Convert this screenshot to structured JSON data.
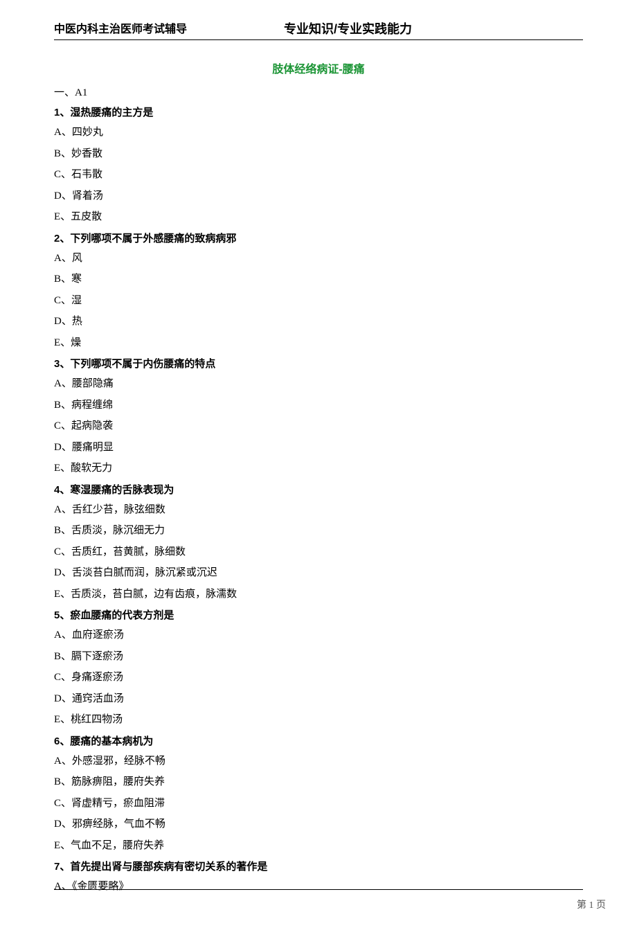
{
  "header": {
    "left": "中医内科主治医师考试辅导",
    "center": "专业知识/专业实践能力"
  },
  "title": "肢体经络病证-腰痛",
  "section_label": "一、A1",
  "questions": [
    {
      "stem": "1、湿热腰痛的主方是",
      "options": [
        "A、四妙丸",
        "B、妙香散",
        "C、石韦散",
        "D、肾着汤",
        "E、五皮散"
      ]
    },
    {
      "stem": "2、下列哪项不属于外感腰痛的致病病邪",
      "options": [
        "A、风",
        "B、寒",
        "C、湿",
        "D、热",
        "E、燥"
      ]
    },
    {
      "stem": "3、下列哪项不属于内伤腰痛的特点",
      "options": [
        "A、腰部隐痛",
        "B、病程缠绵",
        "C、起病隐袭",
        "D、腰痛明显",
        "E、酸软无力"
      ]
    },
    {
      "stem": "4、寒湿腰痛的舌脉表现为",
      "options": [
        "A、舌红少苔，脉弦细数",
        "B、舌质淡，脉沉细无力",
        "C、舌质红，苔黄腻，脉细数",
        "D、舌淡苔白腻而润，脉沉紧或沉迟",
        "E、舌质淡，苔白腻，边有齿痕，脉濡数"
      ]
    },
    {
      "stem": "5、瘀血腰痛的代表方剂是",
      "options": [
        "A、血府逐瘀汤",
        "B、膈下逐瘀汤",
        "C、身痛逐瘀汤",
        "D、通窍活血汤",
        "E、桃红四物汤"
      ]
    },
    {
      "stem": "6、腰痛的基本病机为",
      "options": [
        "A、外感湿邪，经脉不畅",
        "B、筋脉痹阻，腰府失养",
        "C、肾虚精亏，瘀血阻滞",
        "D、邪痹经脉，气血不畅",
        "E、气血不足，腰府失养"
      ]
    },
    {
      "stem": "7、首先提出肾与腰部疾病有密切关系的著作是",
      "options": [
        "A、《金匮要略》"
      ]
    }
  ],
  "page_number": "第 1 页"
}
